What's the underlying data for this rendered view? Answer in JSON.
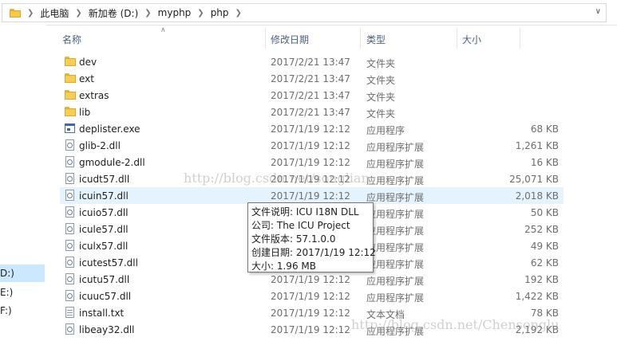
{
  "address_bar": {
    "crumbs": [
      "此电脑",
      "新加卷 (D:)",
      "myphp",
      "php"
    ]
  },
  "nav_pane": {
    "items": [
      {
        "label": "D:)",
        "selected": true
      },
      {
        "label": "E:)",
        "selected": false
      },
      {
        "label": "F:)",
        "selected": false
      }
    ]
  },
  "columns": {
    "name": "名称",
    "date": "修改日期",
    "type": "类型",
    "size": "大小"
  },
  "files": [
    {
      "name": "dev",
      "date": "2017/2/21 13:47",
      "type": "文件夹",
      "size": "",
      "icon": "folder"
    },
    {
      "name": "ext",
      "date": "2017/2/21 13:47",
      "type": "文件夹",
      "size": "",
      "icon": "folder"
    },
    {
      "name": "extras",
      "date": "2017/2/21 13:47",
      "type": "文件夹",
      "size": "",
      "icon": "folder"
    },
    {
      "name": "lib",
      "date": "2017/2/21 13:47",
      "type": "文件夹",
      "size": "",
      "icon": "folder"
    },
    {
      "name": "deplister.exe",
      "date": "2017/1/19 12:12",
      "type": "应用程序",
      "size": "68 KB",
      "icon": "exe"
    },
    {
      "name": "glib-2.dll",
      "date": "2017/1/19 12:12",
      "type": "应用程序扩展",
      "size": "1,261 KB",
      "icon": "dll"
    },
    {
      "name": "gmodule-2.dll",
      "date": "2017/1/19 12:12",
      "type": "应用程序扩展",
      "size": "16 KB",
      "icon": "dll"
    },
    {
      "name": "icudt57.dll",
      "date": "2017/1/19 12:12",
      "type": "应用程序扩展",
      "size": "25,071 KB",
      "icon": "dll"
    },
    {
      "name": "icuin57.dll",
      "date": "2017/1/19 12:12",
      "type": "应用程序扩展",
      "size": "2,018 KB",
      "icon": "dll"
    },
    {
      "name": "icuio57.dll",
      "date": "2017/1/19 12:12",
      "type": "应用程序扩展",
      "size": "50 KB",
      "icon": "dll"
    },
    {
      "name": "icule57.dll",
      "date": "2017/1/19 12:12",
      "type": "应用程序扩展",
      "size": "252 KB",
      "icon": "dll"
    },
    {
      "name": "iculx57.dll",
      "date": "2017/1/19 12:12",
      "type": "应用程序扩展",
      "size": "49 KB",
      "icon": "dll"
    },
    {
      "name": "icutest57.dll",
      "date": "2017/1/19 12:12",
      "type": "应用程序扩展",
      "size": "62 KB",
      "icon": "dll"
    },
    {
      "name": "icutu57.dll",
      "date": "2017/1/19 12:12",
      "type": "应用程序扩展",
      "size": "192 KB",
      "icon": "dll"
    },
    {
      "name": "icuuc57.dll",
      "date": "2017/1/19 12:12",
      "type": "应用程序扩展",
      "size": "1,422 KB",
      "icon": "dll"
    },
    {
      "name": "install.txt",
      "date": "2017/1/19 12:12",
      "type": "文本文档",
      "size": "78 KB",
      "icon": "txt"
    },
    {
      "name": "libeay32.dll",
      "date": "2017/1/19 12:12",
      "type": "应用程序扩展",
      "size": "2,192 KB",
      "icon": "dll"
    }
  ],
  "hovered_file": "icuin57.dll",
  "tooltip": {
    "lines": [
      "文件说明: ICU I18N DLL",
      "公司: The ICU Project",
      "文件版本: 57.1.0.0",
      "创建日期: 2017/1/19 12:12",
      "大小: 1.96 MB"
    ]
  },
  "watermarks": [
    "http://blog.csdn.net/songlian",
    "http://blog.csdn.net/Chensonglu"
  ],
  "colors": {
    "hover_row": "#e5f3ff",
    "selected_nav": "#cce8ff",
    "header_text": "#4d6082",
    "folder": "#f8cd55"
  }
}
